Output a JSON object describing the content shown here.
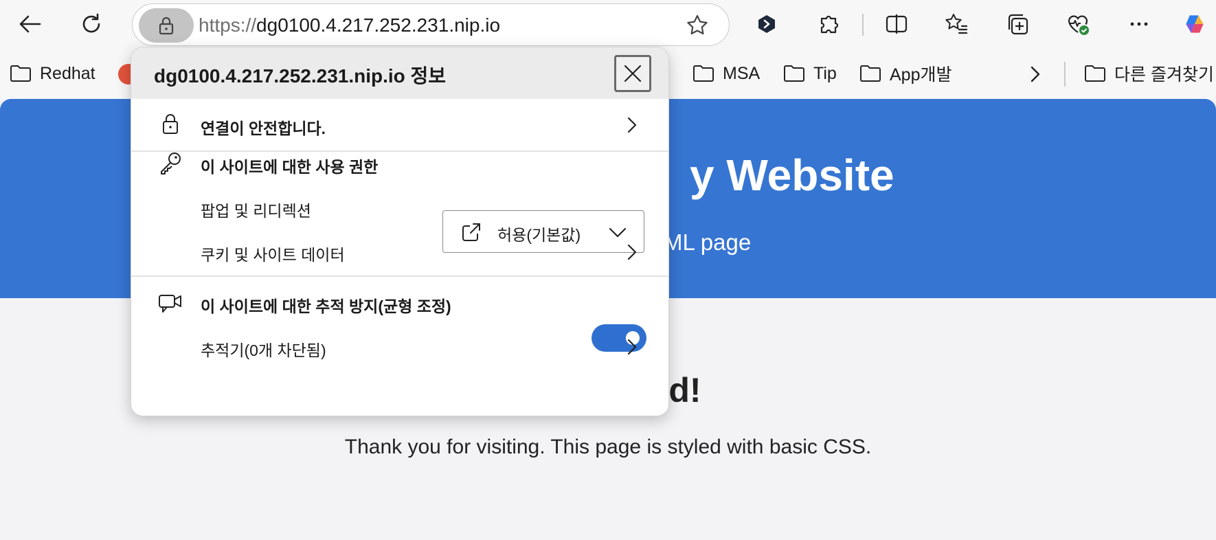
{
  "browser": {
    "address": {
      "scheme": "https://",
      "host": "dg0100.4.217.252.231.nip.io"
    },
    "toolbar_icons": [
      "back-icon",
      "refresh-icon",
      "lock-icon",
      "star-icon",
      "extension-badge-icon",
      "puzzle-icon",
      "split-screen-icon",
      "favorites-icon",
      "collections-icon",
      "browser-essentials-icon",
      "more-icon",
      "copilot-icon"
    ]
  },
  "favorites": {
    "items": [
      {
        "label": "Redhat"
      },
      {
        "label": "MSA"
      },
      {
        "label": "Tip"
      },
      {
        "label": "App개발"
      }
    ],
    "other_label": "다른 즐겨찾기"
  },
  "page": {
    "banner_title": "y Website",
    "banner_subtitle": "ML page",
    "heading": "rld!",
    "text": "Thank you for visiting. This page is styled with basic CSS.",
    "banner_color": "#3675d2"
  },
  "popup": {
    "title": "dg0100.4.217.252.231.nip.io 정보",
    "connection": "연결이 안전합니다.",
    "permissions_title": "이 사이트에 대한 사용 권한",
    "popups_label": "팝업 및 리디렉션",
    "popups_value": "허용(기본값)",
    "cookies_label": "쿠키 및 사이트 데이터",
    "tracking_label": "이 사이트에 대한 추적 방지(균형 조정)",
    "tracking_enabled": true,
    "trackers_label": "추적기(0개 차단됨)",
    "toggle_color": "#2f6fd0"
  }
}
